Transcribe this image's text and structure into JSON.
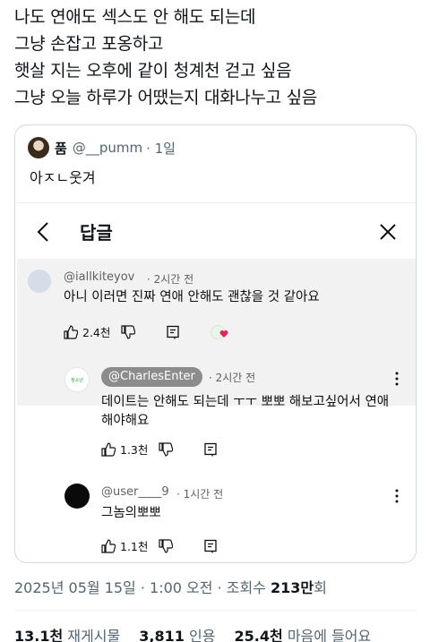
{
  "tweet": {
    "lines": [
      "나도 연애도 섹스도 안 해도 되는데",
      "그냥 손잡고 포옹하고",
      "햇살 지는 오후에 같이 청계천 걷고 싶음",
      "그냥 오늘 하루가 어땠는지 대화나누고 싶음"
    ]
  },
  "quote": {
    "name": "품",
    "handle": "@__pumm",
    "time": "· 1일",
    "text": "아ㅈㄴ웃겨"
  },
  "embed": {
    "title": "답글",
    "comments": [
      {
        "handle": "@iallkiteyov",
        "time": "· 2시간 전",
        "body": "아니 이러면 진짜 연애 안해도 괜찮을 것 같아요",
        "likes": "2.4천"
      },
      {
        "handle": "@CharlesEnter",
        "time": "· 2시간 전",
        "body_line1": "데이트는 안해도 되는데 ㅜㅜ 뽀뽀 해보고싶어서 연애",
        "body_line2": "해야해요",
        "likes": "1.3천"
      },
      {
        "handle": "@user____9",
        "time": "· 1시간 전",
        "body": "그놈의뽀뽀",
        "likes": "1.1천"
      }
    ]
  },
  "footer": {
    "datetime": "2025년 05월 15일 · 1:00 오전 · 조회수 ",
    "views": "213만",
    "views_suffix": "회",
    "retweets": "13.1천",
    "retweets_label": "재게시물",
    "quotes": "3,811",
    "quotes_label": "인용",
    "likes": "25.4천",
    "likes_label": "마음에 들어요"
  }
}
